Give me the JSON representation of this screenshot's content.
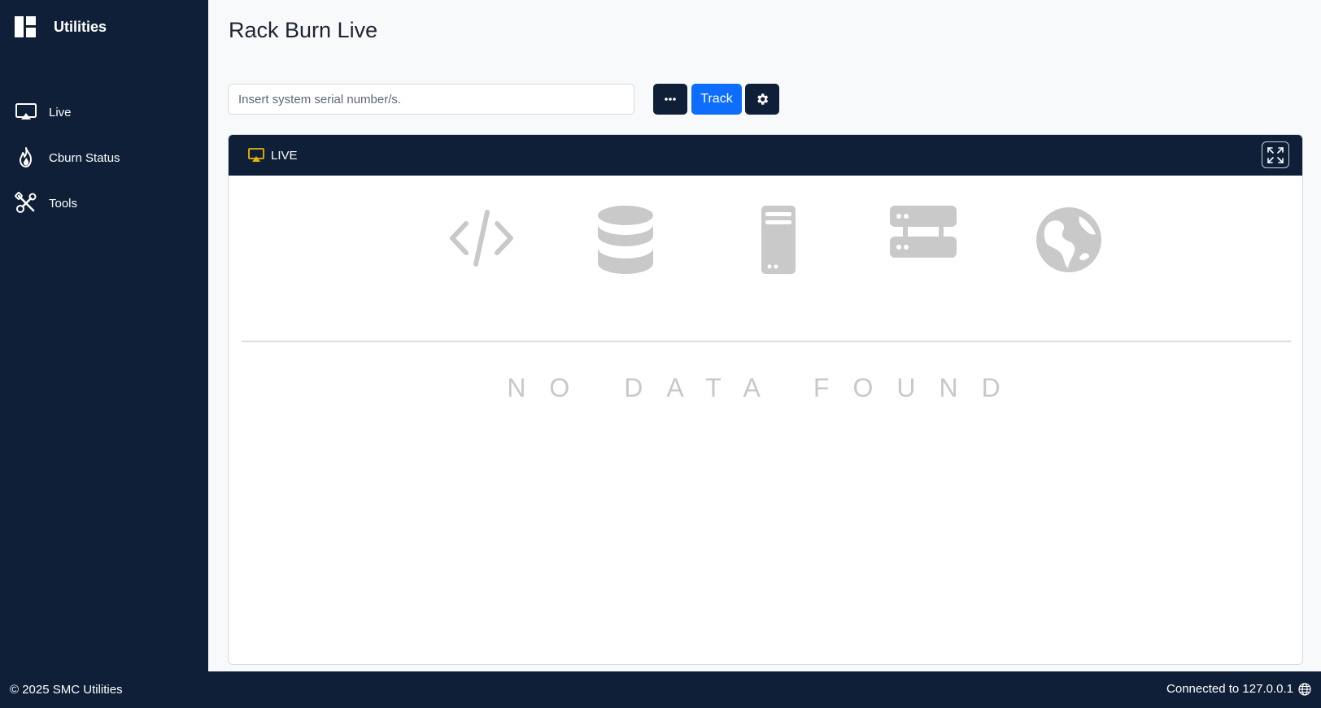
{
  "sidebar": {
    "brand": {
      "label": "Utilities",
      "icon": "dashboard-icon"
    },
    "items": [
      {
        "label": "Live",
        "icon": "airplay-icon"
      },
      {
        "label": "Cburn Status",
        "icon": "fire-icon"
      },
      {
        "label": "Tools",
        "icon": "tools-icon"
      }
    ]
  },
  "main": {
    "title": "Rack Burn Live",
    "search": {
      "placeholder": "Insert system serial number/s.",
      "value": ""
    },
    "buttons": {
      "more_label": "···",
      "track_label": "Track",
      "settings_icon": "gear-icon"
    },
    "card": {
      "title": "LIVE",
      "title_icon": "airplay-icon",
      "title_icon_color": "#f0b400",
      "expand_icon": "fullscreen-icon",
      "empty_icons": [
        "code-icon",
        "database-icon",
        "server-tower-icon",
        "server-rack-icon",
        "globe-icon"
      ],
      "empty_text": "NO DATA FOUND"
    }
  },
  "footer": {
    "copyright": "© 2025 SMC Utilities",
    "status": "Connected to 127.0.0.1",
    "status_icon": "globe-icon"
  },
  "colors": {
    "sidebar_bg": "#0f1f38",
    "accent": "#0d6efd",
    "empty_icon": "#c9c9c9"
  }
}
